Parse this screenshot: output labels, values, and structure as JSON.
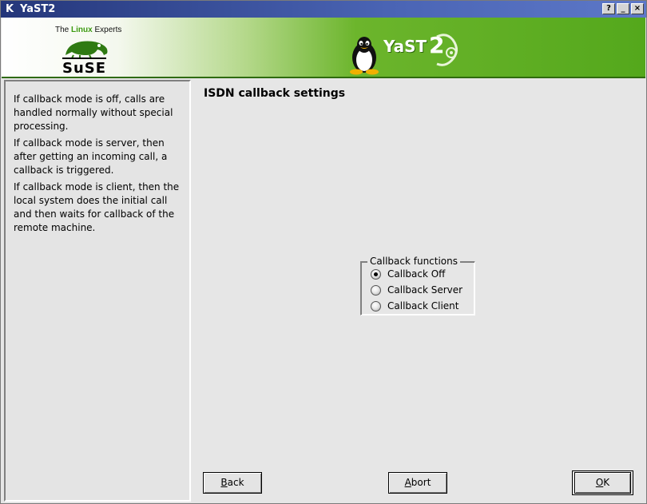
{
  "window": {
    "title": "YaST2",
    "k_glyph": "K",
    "help_button": "?",
    "minimize_button": "_",
    "close_button": "×"
  },
  "banner": {
    "tagline_prefix": "The ",
    "tagline_highlight": "Linux",
    "tagline_suffix": " Experts",
    "suse_text": "SuSE",
    "yast_text": "YaST",
    "yast_version": "2",
    "colors": {
      "banner_green": "#54a81c",
      "tagline_green": "#3c9a10"
    }
  },
  "help": {
    "paragraphs": [
      "If callback mode is off, calls are handled normally without special processing.",
      "If callback mode is server, then after getting an incoming call, a callback is triggered.",
      "If callback mode is client, then the local system does the initial call and then waits for callback of the remote machine."
    ]
  },
  "main": {
    "heading": "ISDN callback settings",
    "group_title": "Callback functions",
    "options": [
      {
        "label": "Callback Off",
        "checked": true
      },
      {
        "label": "Callback Server",
        "checked": false
      },
      {
        "label": "Callback Client",
        "checked": false
      }
    ]
  },
  "buttons": {
    "back_accel": "B",
    "back_rest": "ack",
    "abort_accel": "A",
    "abort_rest": "bort",
    "ok_accel": "O",
    "ok_rest": "K"
  }
}
